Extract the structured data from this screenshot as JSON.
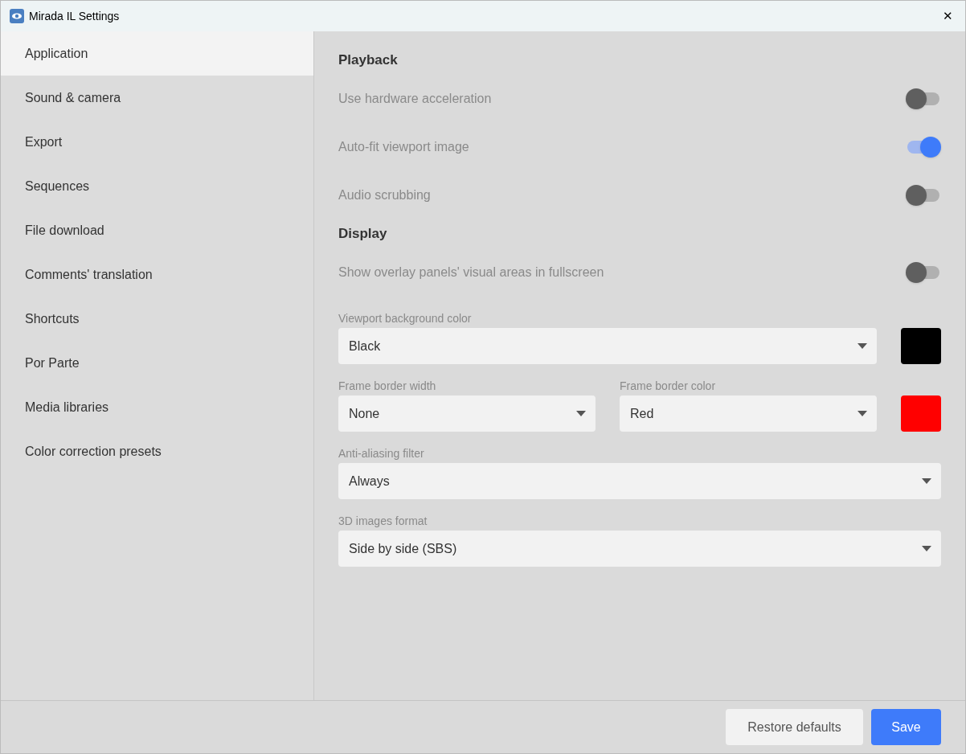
{
  "window": {
    "title": "Mirada IL Settings",
    "close": "✕"
  },
  "sidebar": {
    "items": [
      {
        "label": "Application",
        "selected": true
      },
      {
        "label": "Sound & camera",
        "selected": false
      },
      {
        "label": "Export",
        "selected": false
      },
      {
        "label": "Sequences",
        "selected": false
      },
      {
        "label": "File download",
        "selected": false
      },
      {
        "label": "Comments' translation",
        "selected": false
      },
      {
        "label": "Shortcuts",
        "selected": false
      },
      {
        "label": "Por Parte",
        "selected": false
      },
      {
        "label": "Media libraries",
        "selected": false
      },
      {
        "label": "Color correction presets",
        "selected": false
      }
    ]
  },
  "content": {
    "sections": [
      {
        "title": "Playback",
        "toggles": [
          {
            "label": "Use hardware acceleration",
            "on": false
          },
          {
            "label": "Auto-fit viewport image",
            "on": true
          },
          {
            "label": "Audio scrubbing",
            "on": false
          }
        ]
      },
      {
        "title": "Display",
        "toggles": [
          {
            "label": "Show overlay panels' visual areas in fullscreen",
            "on": false
          }
        ],
        "fields": [
          [
            {
              "label": "Viewport background color",
              "value": "Black"
            },
            {
              "kind": "swatch",
              "color": "#000000"
            }
          ],
          [
            {
              "label": "Frame border width",
              "value": "None"
            },
            {
              "label": "Frame border color",
              "value": "Red"
            },
            {
              "kind": "swatch",
              "color": "#ff0000"
            }
          ],
          [
            {
              "label": "Anti-aliasing filter",
              "value": "Always"
            }
          ],
          [
            {
              "label": "3D images format",
              "value": "Side by side (SBS)"
            }
          ]
        ]
      }
    ]
  },
  "footer": {
    "buttons": [
      {
        "label": "Restore defaults",
        "kind": "secondary"
      },
      {
        "label": "Save",
        "kind": "primary"
      }
    ]
  }
}
